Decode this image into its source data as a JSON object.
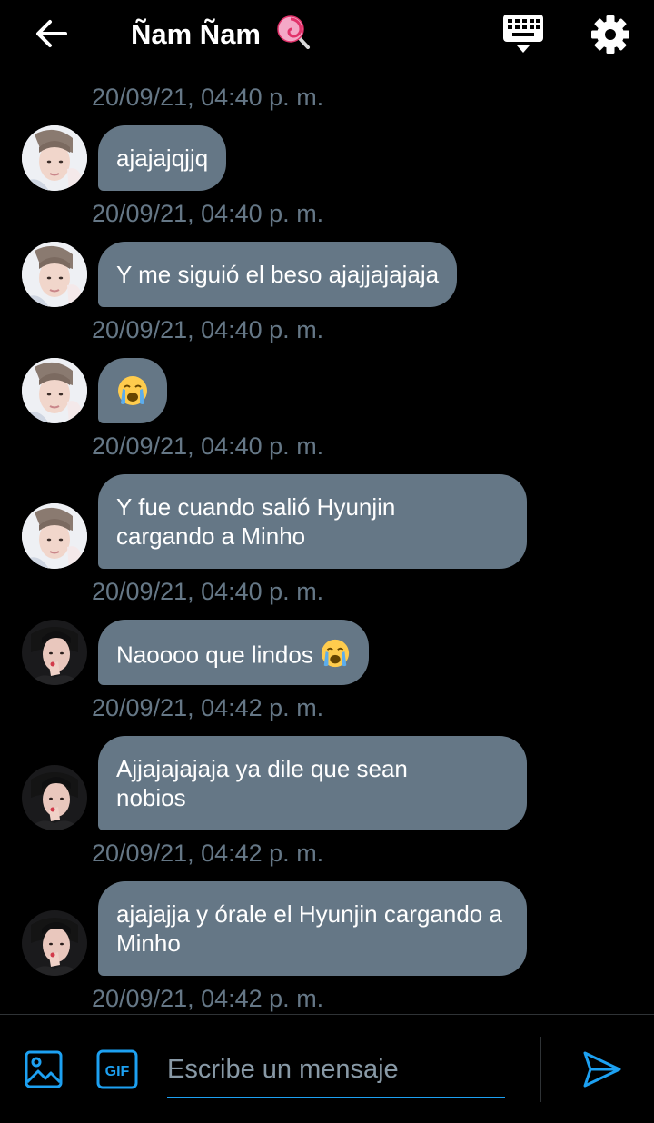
{
  "header": {
    "title": "Ñam Ñam",
    "title_emoji": "lollipop-icon",
    "back_icon": "arrow-left-icon",
    "keyboard_icon": "keyboard-icon",
    "settings_icon": "gear-icon"
  },
  "conversation": {
    "first_timestamp": "20/09/21, 04:40 p. m.",
    "messages": [
      {
        "text": "ajajajqjjq",
        "timestamp": "20/09/21, 04:40 p. m.",
        "avatar": "user-a"
      },
      {
        "text": "Y me siguió el beso ajajjajajaja",
        "timestamp": "20/09/21, 04:40 p. m.",
        "avatar": "user-a"
      },
      {
        "text": "",
        "emoji": "crying-face-icon",
        "timestamp": "20/09/21, 04:40 p. m.",
        "avatar": "user-a"
      },
      {
        "text": "Y fue cuando salió Hyunjin cargando a Minho",
        "timestamp": "20/09/21, 04:40 p. m.",
        "avatar": "user-a"
      },
      {
        "text": "Naoooo que lindos",
        "emoji": "crying-face-icon",
        "timestamp": "20/09/21, 04:42 p. m.",
        "avatar": "user-b"
      },
      {
        "text": "Ajjajajajaja ya dile que sean nobios",
        "timestamp": "20/09/21, 04:42 p. m.",
        "avatar": "user-b"
      },
      {
        "text": "ajajajja y órale el Hyunjin cargando a Minho",
        "timestamp": "20/09/21, 04:42 p. m.",
        "avatar": "user-b"
      }
    ]
  },
  "composer": {
    "placeholder": "Escribe un mensaje",
    "value": "",
    "image_icon": "image-icon",
    "gif_label": "GIF",
    "send_icon": "send-icon"
  },
  "colors": {
    "background": "#000000",
    "bubble": "#657786",
    "timestamp": "#657786",
    "accent": "#1da1f2"
  }
}
